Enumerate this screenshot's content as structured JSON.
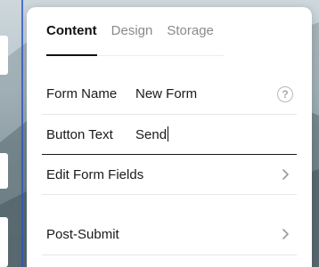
{
  "tabs": [
    {
      "label": "Content",
      "active": true
    },
    {
      "label": "Design",
      "active": false
    },
    {
      "label": "Storage",
      "active": false
    }
  ],
  "fields": {
    "form_name": {
      "label": "Form Name",
      "value": "New Form",
      "help_icon": "question-circle-icon"
    },
    "button_text": {
      "label": "Button Text",
      "value": "Send"
    }
  },
  "links": {
    "edit_form_fields": {
      "label": "Edit Form Fields",
      "icon": "chevron-right-icon"
    },
    "post_submit": {
      "label": "Post-Submit",
      "icon": "chevron-right-icon"
    }
  },
  "colors": {
    "accent_line": "#2f57c7",
    "text": "#1a1a1a",
    "muted_tab": "#8a8a8a"
  }
}
